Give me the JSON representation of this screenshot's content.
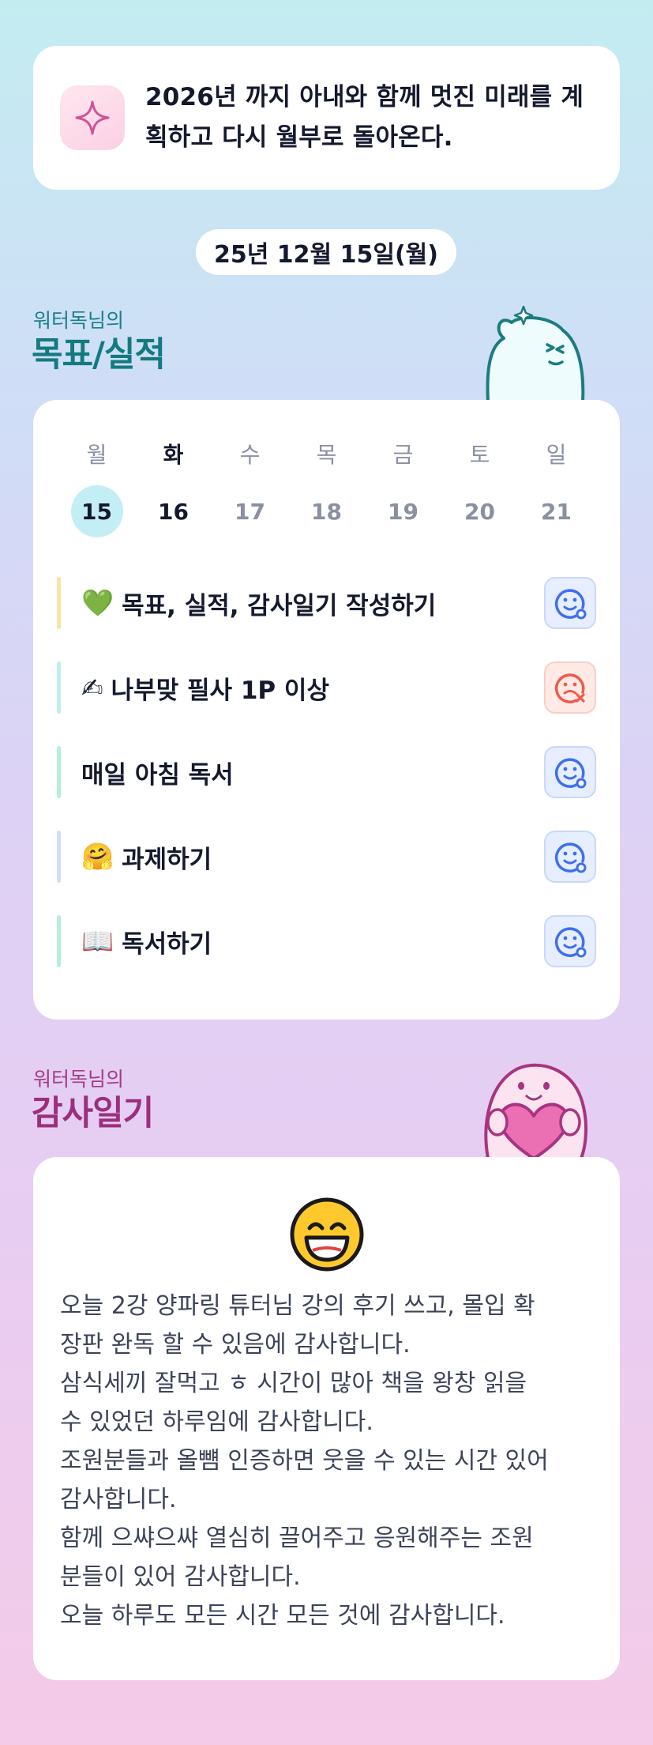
{
  "goal": {
    "icon": "sparkle-icon",
    "text_line1": "2026년 까지 아내와 함께 멋진 미래를 계",
    "text_line2": "획하고 다시 월부로 돌아온다."
  },
  "date": "25년 12월 15일(월)",
  "goals_section": {
    "subtitle": "워터독님의",
    "title": "목표/실적",
    "mascot": "mascot-character-icon"
  },
  "week": {
    "day_names": [
      "월",
      "화",
      "수",
      "목",
      "금",
      "토",
      "일"
    ],
    "day_numbers": [
      "15",
      "16",
      "17",
      "18",
      "19",
      "20",
      "21"
    ],
    "selected_index": 0,
    "today_index": 1
  },
  "tasks": [
    {
      "emoji": "💚",
      "label": "목표, 실적, 감사일기 작성하기",
      "bar_color": "#fbe3a8",
      "status": "done"
    },
    {
      "emoji": "✍",
      "label": "나부맞 필사 1P 이상",
      "bar_color": "#bdeef0",
      "status": "missed"
    },
    {
      "emoji": "",
      "label": "매일 아침 독서",
      "bar_color": "#b6f0d8",
      "status": "done"
    },
    {
      "emoji": "🤗",
      "label": "과제하기",
      "bar_color": "#d3dcf7",
      "status": "done"
    },
    {
      "emoji": "📖",
      "label": "독서하기",
      "bar_color": "#b6f0d8",
      "status": "done"
    }
  ],
  "gratitude_section": {
    "subtitle": "워터독님의",
    "title": "감사일기",
    "mascot": "mascot-heart-icon",
    "mood": "grinning-face-icon",
    "lines": [
      "오늘 2강 양파링 튜터님 강의 후기 쓰고, 몰입 확",
      "장판 완독 할 수 있음에 감사합니다.",
      "삼식세끼 잘먹고 ㅎ 시간이 많아 책을 왕창 읽을",
      "수 있었던 하루임에 감사합니다.",
      "조원분들과 올뻄 인증하면 웃을 수 있는 시간 있어",
      "감사합니다.",
      "함께 으쌰으쌰 열심히 끌어주고 응원해주는 조원",
      "분들이 있어 감사합니다.",
      "오늘 하루도 모든 시간 모든 것에 감사합니다."
    ]
  },
  "colors": {
    "accent_teal": "#137a80",
    "accent_pink": "#9c2f7d",
    "status_done": "#3f6ff0",
    "status_missed": "#ef5a4a"
  }
}
